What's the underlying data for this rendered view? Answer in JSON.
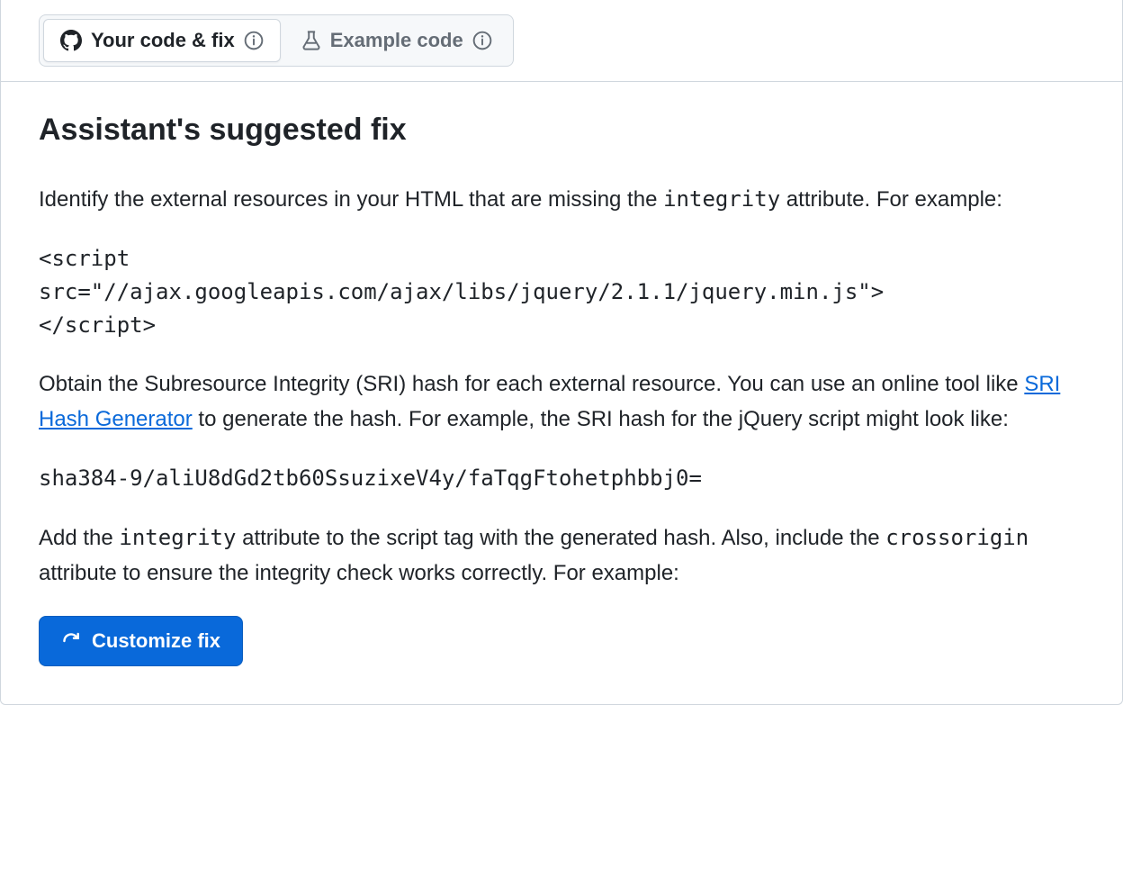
{
  "tabs": {
    "your_code": "Your code & fix",
    "example_code": "Example code"
  },
  "heading": "Assistant's suggested fix",
  "intro_part1": "Identify the external resources in your HTML that are missing the ",
  "intro_code": "integrity",
  "intro_part2": " attribute. For example:",
  "code_block1": "<script\nsrc=\"//ajax.googleapis.com/ajax/libs/jquery/2.1.1/jquery.min.js\">\n</script>",
  "para2_part1": "Obtain the Subresource Integrity (SRI) hash for each external resource. You can use an online tool like ",
  "para2_link": "SRI Hash Generator",
  "para2_part2": " to generate the hash. For example, the SRI hash for the jQuery script might look like:",
  "code_block2": "sha384-9/aliU8dGd2tb60SsuzixeV4y/faTqgFtohetphbbj0=",
  "para3_part1": "Add the ",
  "para3_code1": "integrity",
  "para3_part2": " attribute to the script tag with the generated hash. Also, include the ",
  "para3_code2": "crossorigin",
  "para3_part3": " attribute to ensure the integrity check works correctly. For example:",
  "customize_button": "Customize fix"
}
